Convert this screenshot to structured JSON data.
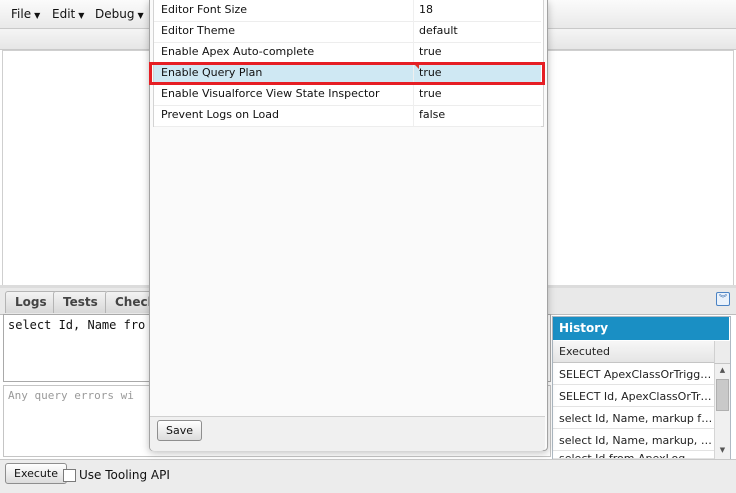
{
  "menu": [
    {
      "label": "File"
    },
    {
      "label": "Edit"
    },
    {
      "label": "Debug"
    }
  ],
  "settings": {
    "rows": [
      {
        "name": "Editor Font Size",
        "value": "18"
      },
      {
        "name": "Editor Theme",
        "value": "default"
      },
      {
        "name": "Enable Apex Auto-complete",
        "value": "true"
      },
      {
        "name": "Enable Query Plan",
        "value": "true"
      },
      {
        "name": "Enable Visualforce View State Inspector",
        "value": "true"
      },
      {
        "name": "Prevent Logs on Load",
        "value": "false"
      }
    ],
    "save_label": "Save"
  },
  "tabs": [
    {
      "label": "Logs"
    },
    {
      "label": "Tests"
    },
    {
      "label": "Check"
    }
  ],
  "query_text": "select Id, Name fro",
  "errors_placeholder": "Any query errors wi",
  "history": {
    "title": "History",
    "column": "Executed",
    "items": [
      "SELECT ApexClassOrTrigger...",
      "SELECT Id, ApexClassOrTrig...",
      "select Id, Name, markup fro...",
      "select Id, Name, markup, co...",
      "select Id from ApexLog"
    ]
  },
  "statusbar": {
    "execute_label": "Execute",
    "tooling_label": "Use Tooling API"
  },
  "colors": {
    "history_header": "#1a8fc4",
    "selected_row": "#cfe8f3",
    "highlight_border": "#e61e24"
  }
}
